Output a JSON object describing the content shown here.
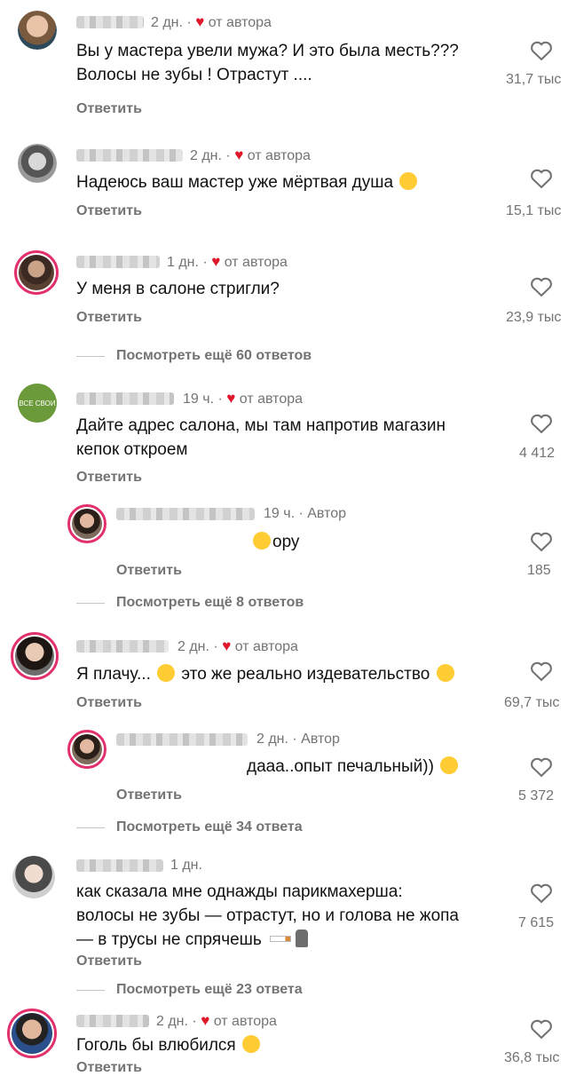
{
  "comments": [
    {
      "meta": "2 дн. · ",
      "author_badge": "от автора",
      "lines": [
        "Вы у мастера увели мужа?  И это была месть???",
        "Волосы не зубы ! Отрастут ...."
      ],
      "reply": "Ответить",
      "likes": "31,7 тыс"
    },
    {
      "meta": "2 дн. · ",
      "author_badge": "от автора",
      "lines": [
        "Надеюсь ваш мастер уже мёртвая душа"
      ],
      "reply": "Ответить",
      "likes": "15,1 тыс"
    },
    {
      "meta": "1 дн. · ",
      "author_badge": "от автора",
      "lines": [
        "У меня в салоне стригли?"
      ],
      "reply": "Ответить",
      "likes": "23,9 тыс",
      "more": "Посмотреть ещё 60 ответов"
    },
    {
      "meta": "19 ч. · ",
      "author_badge": "от автора",
      "lines": [
        "Дайте адрес салона, мы там напротив магазин",
        "кепок откроем"
      ],
      "reply": "Ответить",
      "likes": "4 412",
      "avatar_text": "ВСЕ СВОИ"
    },
    {
      "meta": "19 ч. · Автор",
      "lines": [
        "ору"
      ],
      "reply": "Ответить",
      "likes": "185",
      "more": "Посмотреть ещё 8 ответов"
    },
    {
      "meta": "2 дн. · ",
      "author_badge": "от автора",
      "lines": [
        "Я плачу...",
        "это же реально издевательство"
      ],
      "reply": "Ответить",
      "likes": "69,7 тыс"
    },
    {
      "meta": "2 дн. · Автор",
      "lines": [
        "дааа..опыт печальный))"
      ],
      "reply": "Ответить",
      "likes": "5 372",
      "more": "Посмотреть ещё 34 ответа"
    },
    {
      "meta": "1 дн.",
      "lines": [
        "как сказала мне однажды парикмахерша:",
        "волосы не зубы — отрастут, но и голова не жопа",
        "— в трусы не спрячешь"
      ],
      "reply": "Ответить",
      "likes": "7 615",
      "more": "Посмотреть ещё 23 ответа"
    },
    {
      "meta": "2 дн. · ",
      "author_badge": "от автора",
      "lines": [
        "Гоголь бы влюбился"
      ],
      "reply": "Ответить",
      "likes": "36,8 тыс"
    }
  ],
  "icons": {
    "like": "heart-outline-icon",
    "author_like": "red-heart-icon"
  },
  "colors": {
    "author_heart": "#e0162b",
    "muted_text": "#737373",
    "avatar_ring": "#e1306c"
  }
}
